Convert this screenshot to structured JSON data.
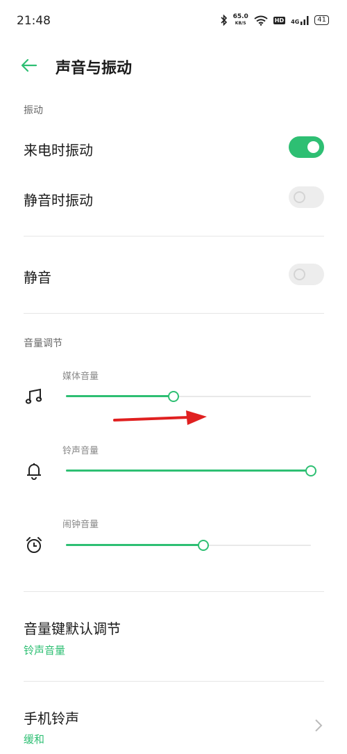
{
  "status_bar": {
    "time": "21:48",
    "speed_value": "65.0",
    "speed_unit": "KB/S",
    "hd": "HD",
    "network": "4G",
    "battery": "41"
  },
  "header": {
    "title": "声音与振动"
  },
  "vibration": {
    "section_label": "振动",
    "ring_vibrate": {
      "label": "来电时振动",
      "on": true
    },
    "silent_vibrate": {
      "label": "静音时振动",
      "on": false
    }
  },
  "mute": {
    "label": "静音",
    "on": false
  },
  "volume": {
    "section_label": "音量调节",
    "media": {
      "label": "媒体音量",
      "level": 0.44,
      "icon": "music-note-icon"
    },
    "ringtone": {
      "label": "铃声音量",
      "level": 1.0,
      "icon": "bell-icon"
    },
    "alarm": {
      "label": "闹钟音量",
      "level": 0.56,
      "icon": "alarm-clock-icon"
    }
  },
  "volume_key_default": {
    "label": "音量键默认调节",
    "value": "铃声音量"
  },
  "phone_ringtone": {
    "label": "手机铃声",
    "value": "缓和"
  },
  "colors": {
    "accent": "#2ebf73",
    "annotation_arrow": "#e02020"
  }
}
